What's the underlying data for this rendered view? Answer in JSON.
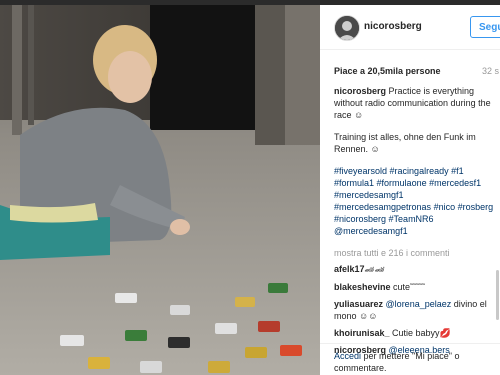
{
  "post": {
    "username": "nicorosberg",
    "follow_label": "Segu",
    "likes": "Piace a 20,5mila persone",
    "time": "32 s",
    "caption_user": "nicorosberg",
    "caption_text": " Practice is everything without radio communication during the race",
    "caption_emoji": "☺",
    "caption_de": "Training ist alles, ohne den Funk im Rennen.",
    "caption_de_emoji": "☺",
    "hashtags": [
      "#fiveyearsold",
      "#racingalready",
      "#f1",
      "#formula1",
      "#formulaone",
      "#mercedesf1",
      "#mercedesamgf1",
      "#mercedesamgpetronas",
      "#nico",
      "#rosberg",
      "#nicorosberg",
      "#TeamNR6",
      "@mercedesamgf1"
    ],
    "show_all": "mostra tutti e 216 i commenti",
    "comments": [
      {
        "user": "afelk17",
        "text": " 🏎🏎"
      },
      {
        "user": "blakeshevine",
        "text": " cute˜˜˜˜˜"
      },
      {
        "user": "yuliasuarez",
        "mention": "@lorena_pelaez",
        "text": " divino el mono ☺☺"
      },
      {
        "user": "khoirunisak_",
        "text": " Cutie babyy💋"
      },
      {
        "user": "nicorosberg",
        "mention": "@eleeena.bers",
        "text": ""
      }
    ],
    "footer_link": "Accedi",
    "footer_text": " per mettere \"Mi piace\" o commentare."
  }
}
